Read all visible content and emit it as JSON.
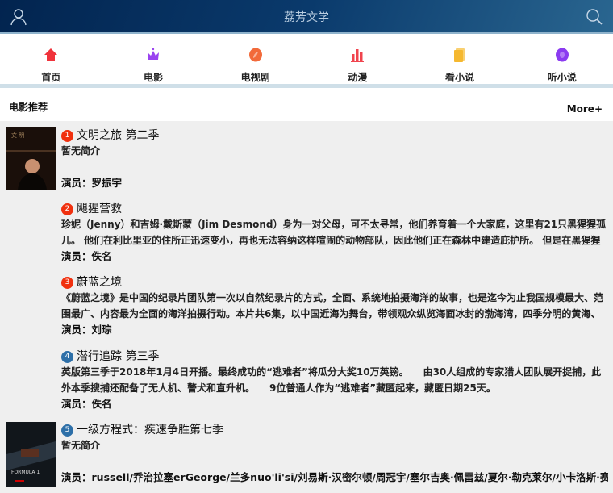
{
  "header": {
    "title": "荔芳文学",
    "user_icon": "user-icon",
    "search_icon": "search-icon"
  },
  "nav": [
    {
      "label": "首页",
      "icon": "home-icon",
      "color": "#f0333b"
    },
    {
      "label": "电影",
      "icon": "crown-icon",
      "color": "#9a43f0"
    },
    {
      "label": "电视剧",
      "icon": "leaf-icon",
      "color": "#f26a3a"
    },
    {
      "label": "动漫",
      "icon": "bars-icon",
      "color": "#f0444e"
    },
    {
      "label": "看小说",
      "icon": "book-icon",
      "color": "#f5b830"
    },
    {
      "label": "听小说",
      "icon": "audio-icon",
      "color": "#8b3bf0"
    }
  ],
  "section": {
    "title": "电影推荐",
    "more": "More+"
  },
  "items": [
    {
      "num": "1",
      "num_color": "#f0300e",
      "title": "文明之旅 第二季",
      "desc": "暂无简介",
      "actor": "演员：罗振宇",
      "has_thumb": true
    },
    {
      "num": "2",
      "num_color": "#f0300e",
      "title": "飓猩营救",
      "desc": "珍妮（Jenny）和吉姆·戴斯蒙（Jim Desmond）身为一对父母，可不太寻常，他们养育着一个大家庭，这里有21只黑猩猩孤儿。 他们在利比里亚的住所正迅速变小，再也无法容纳这样喧闹的动物部队，因此他们正在森林中建造庇护所。 但是在黑猩猩宝宝迁出之前，它们",
      "actor": "演员：佚名",
      "has_thumb": false
    },
    {
      "num": "3",
      "num_color": "#f0300e",
      "title": "蔚蓝之境",
      "desc": "《蔚蓝之境》是中国的纪录片团队第一次以自然纪录片的方式，全面、系统地拍摄海洋的故事，也是迄今为止我国规模最大、范围最广、内容最为全面的海洋拍摄行动。本片共6集，以中国近海为舞台，带领观众纵览海面冰封的渤海湾，四季分明的黄海、东海，长夏无",
      "actor": "演员：刘琮",
      "has_thumb": false
    },
    {
      "num": "4",
      "num_color": "#2d6fa8",
      "title": "潜行追踪 第三季",
      "desc": "英版第三季于2018年1月4日开播。最终成功的“逃难者”将瓜分大奖10万英镑。　　由30人组成的专家猎人团队展开捉捕，此外本季搜捕还配备了无人机、警犬和直升机。　　9位普通人作为“逃难者”藏匿起来，藏匿日期25天。",
      "actor": "演员：佚名",
      "has_thumb": false
    },
    {
      "num": "5",
      "num_color": "#2d6fa8",
      "title": "一级方程式：疾速争胜第七季",
      "desc": "暂无简介",
      "actor": "演员：russell/乔治拉塞erGeorge/兰多nuo'li'si/刘易斯·汉密尔顿/周冠宇/塞尔吉奥·佩雷兹/夏尔·勒克莱尔/小卡洛斯·赛恩斯/瓦尔",
      "has_thumb": true
    }
  ]
}
